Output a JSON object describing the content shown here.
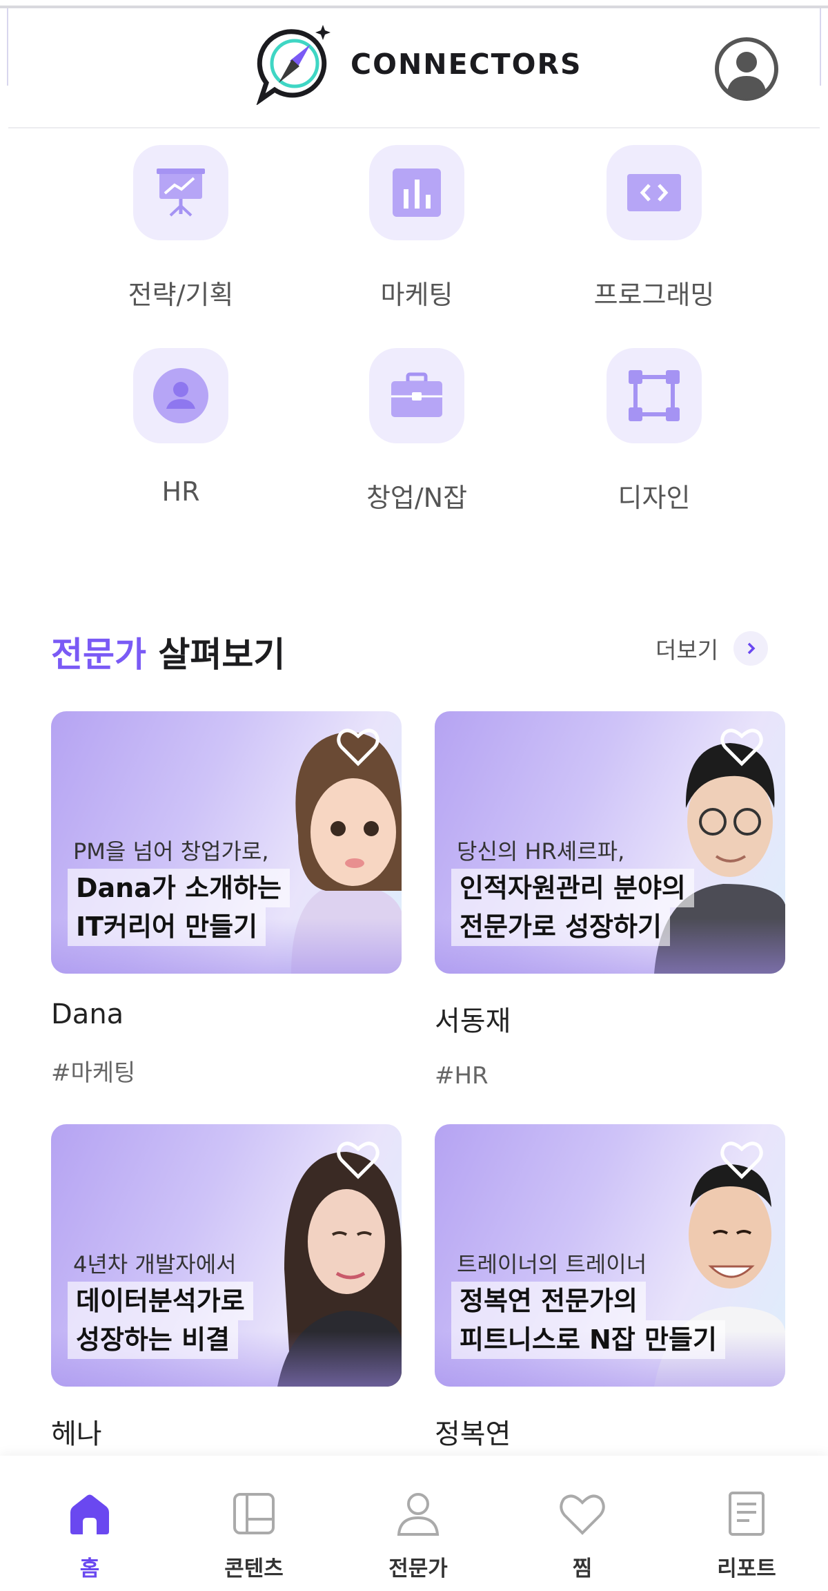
{
  "header": {
    "brand": "CONNECTORS",
    "logo_icon": "compass-chat-logo",
    "profile_icon": "user-circle-icon"
  },
  "categories": [
    {
      "label": "전략/기획",
      "icon": "presentation-chart-icon"
    },
    {
      "label": "마케팅",
      "icon": "bar-chart-icon"
    },
    {
      "label": "프로그래밍",
      "icon": "code-icon"
    },
    {
      "label": "HR",
      "icon": "person-icon"
    },
    {
      "label": "창업/N잡",
      "icon": "briefcase-icon"
    },
    {
      "label": "디자인",
      "icon": "vector-square-icon"
    }
  ],
  "experts_section": {
    "title_accent": "전문가",
    "title_rest": " 살펴보기",
    "more_label": "더보기"
  },
  "experts": [
    {
      "subtitle": "PM을 넘어 창업가로,",
      "title_line1": "Dana가 소개하는",
      "title_line2": "IT커리어 만들기",
      "name": "Dana",
      "tag": "#마케팅"
    },
    {
      "subtitle": "당신의 HR셰르파,",
      "title_line1": "인적자원관리 분야의",
      "title_line2": "전문가로 성장하기",
      "name": "서동재",
      "tag": "#HR"
    },
    {
      "subtitle": "4년차 개발자에서",
      "title_line1": "데이터분석가로",
      "title_line2": "성장하는 비결",
      "name": "헤나",
      "tag": ""
    },
    {
      "subtitle": "트레이너의 트레이너",
      "title_line1": "정복연 전문가의",
      "title_line2": "피트니스로 N잡 만들기",
      "name": "정복연",
      "tag": ""
    }
  ],
  "bottom_nav": [
    {
      "label": "홈",
      "icon": "home-icon",
      "active": true
    },
    {
      "label": "콘텐츠",
      "icon": "layout-icon",
      "active": false
    },
    {
      "label": "전문가",
      "icon": "user-icon",
      "active": false
    },
    {
      "label": "찜",
      "icon": "heart-icon",
      "active": false
    },
    {
      "label": "리포트",
      "icon": "document-icon",
      "active": false
    }
  ],
  "colors": {
    "accent": "#7a5af5",
    "tile_bg": "#efecfd",
    "icon_fill": "#b6a5f6"
  }
}
